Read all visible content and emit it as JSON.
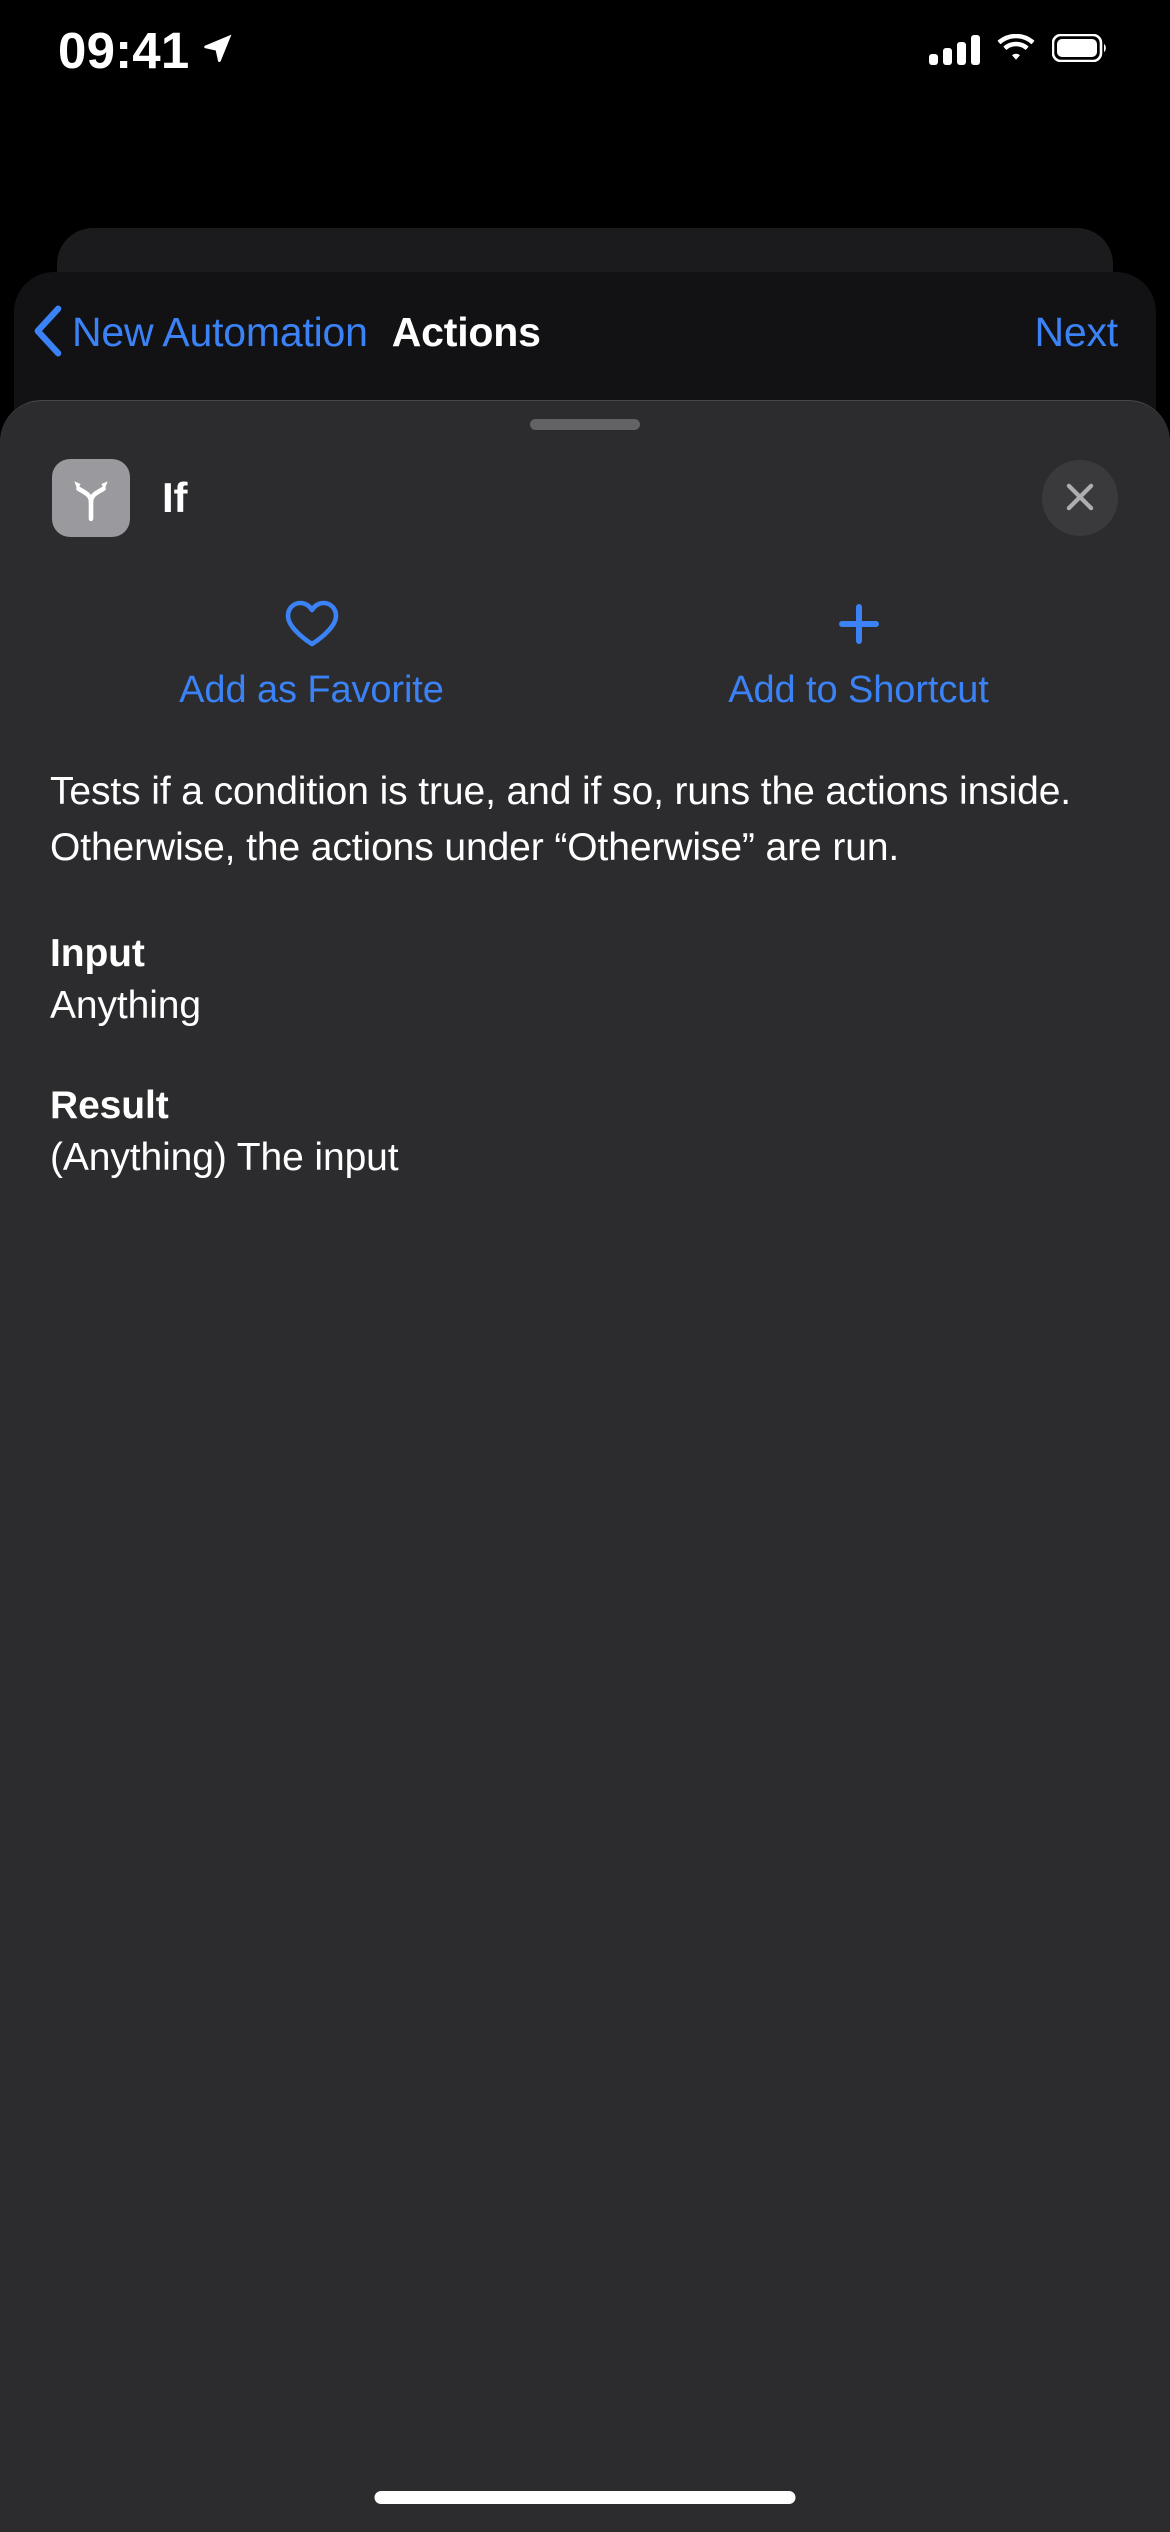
{
  "colors": {
    "accent": "#3b82f6",
    "sheet_bg": "#2c2c2e",
    "screen_bg": "#000000",
    "icon_tile": "#9a9a9e",
    "close_bg": "#3a3a3c",
    "grabber": "#636366"
  },
  "status_bar": {
    "time": "09:41",
    "location_icon": "location-arrow-icon",
    "signal_icon": "cellular-signal-icon",
    "wifi_icon": "wifi-icon",
    "battery_icon": "battery-full-icon"
  },
  "nav": {
    "back_icon": "chevron-left-icon",
    "back_label": "New Automation",
    "title": "Actions",
    "next_label": "Next"
  },
  "sheet": {
    "grabber": "sheet-grabber",
    "icon": "if-branch-icon",
    "title": "If",
    "close_icon": "close-icon",
    "quick_actions": [
      {
        "icon": "heart-icon",
        "label": "Add as Favorite"
      },
      {
        "icon": "plus-icon",
        "label": "Add to Shortcut"
      }
    ],
    "description": "Tests if a condition is true, and if so, runs the actions inside. Otherwise, the actions under “Otherwise” are run.",
    "meta": [
      {
        "label": "Input",
        "value": "Anything"
      },
      {
        "label": "Result",
        "value": "(Anything) The input"
      }
    ]
  },
  "home_indicator": "home-indicator"
}
